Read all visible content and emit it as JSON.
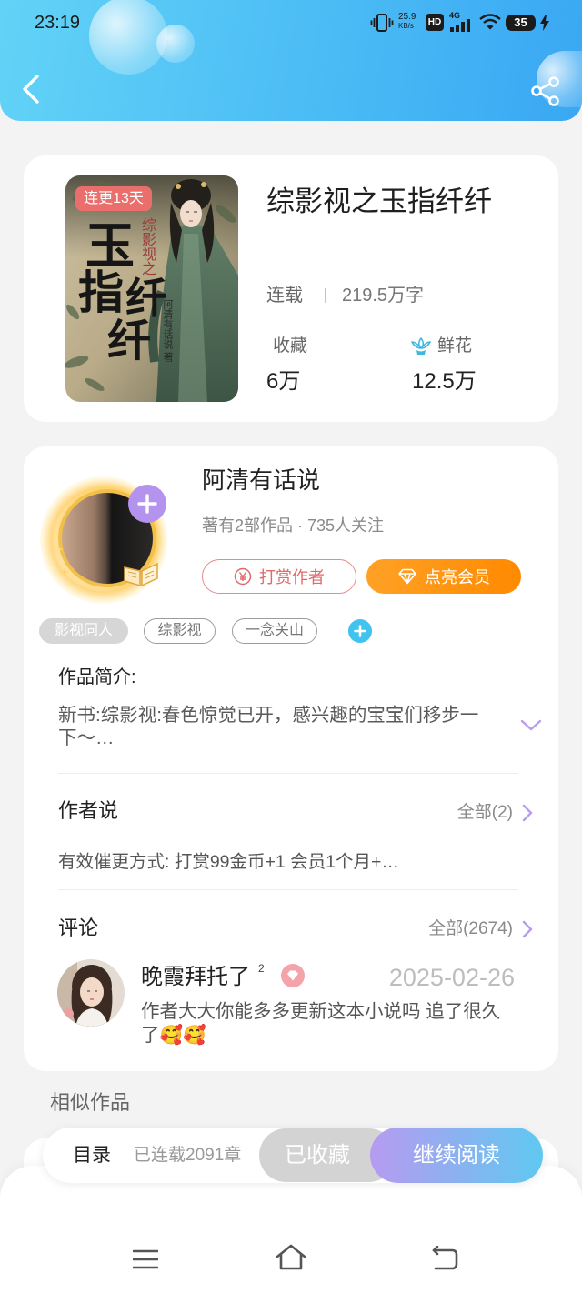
{
  "status_bar": {
    "time": "23:19",
    "net_speed_value": "25.9",
    "net_speed_unit": "KB/s",
    "hd_badge": "HD",
    "network_type": "4G",
    "battery_level": "35"
  },
  "book": {
    "title": "综影视之玉指纤纤",
    "status": "连载",
    "word_count": "219.5万字",
    "favorites_label": "收藏",
    "favorites_value": "6万",
    "flowers_label": "鲜花",
    "flowers_value": "12.5万",
    "cover": {
      "badge": "连更13天",
      "subtitle": "综影视之",
      "title_chars": [
        "玉",
        "指",
        "纤",
        "纤"
      ],
      "author_text": "阿清有话说 著"
    }
  },
  "author": {
    "name": "阿清有话说",
    "stats": "著有2部作品 · 735人关注",
    "tip_button": "打赏作者",
    "vip_button": "点亮会员"
  },
  "tags": [
    "影视同人",
    "综影视",
    "一念关山"
  ],
  "intro": {
    "label": "作品简介:",
    "text": "新书:综影视:春色惊觉已开，感兴趣的宝宝们移步一下～…"
  },
  "author_says": {
    "label": "作者说",
    "all_link": "全部(2)",
    "text": "有效催更方式: 打赏99金币+1 会员1个月+…"
  },
  "comments": {
    "label": "评论",
    "all_link": "全部(2674)",
    "items": [
      {
        "user": "晚霞拜托了",
        "level": "2",
        "date": "2025-02-26",
        "text": "作者大大你能多多更新这本小说吗 追了很久了🥰🥰"
      }
    ]
  },
  "similar": {
    "label": "相似作品"
  },
  "bottom_bar": {
    "toc": "目录",
    "chapter_count": "已连载2091章",
    "favorited": "已收藏",
    "continue_reading": "继续阅读"
  },
  "icons": [
    "vibrate-icon",
    "hd-icon",
    "signal-icon",
    "wifi-icon",
    "battery-icon",
    "charging-icon",
    "chevron-left-icon",
    "share-icon",
    "flower-icon",
    "plus-icon",
    "yen-icon",
    "diamond-icon",
    "chevron-down-icon",
    "chevron-right-icon",
    "menu-icon",
    "home-icon",
    "back-nav-icon"
  ],
  "colors": {
    "header_gradient_start": "#62d3f6",
    "header_gradient_end": "#3aa7f3",
    "accent_purple": "#b79bf0",
    "vip_orange": "#ff9416",
    "tip_red": "#e06a6a",
    "tag_plus_cyan": "#3fc3ef",
    "continue_gradient_start": "#b79bf0",
    "continue_gradient_end": "#5fc8f1",
    "favorited_gray": "#d3d3d3"
  }
}
